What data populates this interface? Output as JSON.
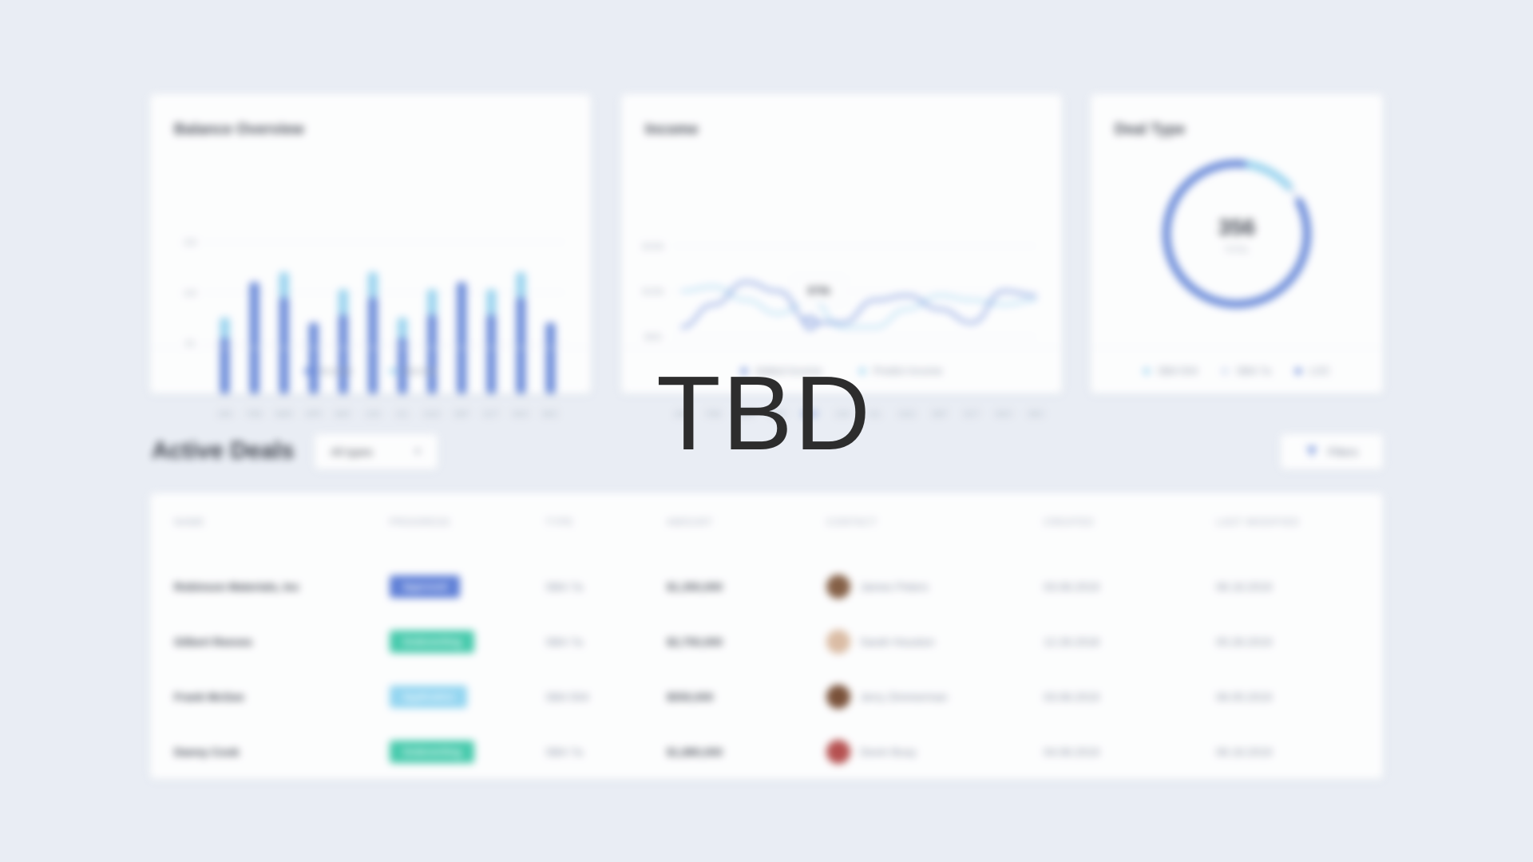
{
  "overlay_text": "TBD",
  "colors": {
    "primary": "#5b7fd6",
    "light": "#8fd0ee",
    "teal": "#34c6a4",
    "sky": "#8ad3f0",
    "background": "#e9edf4"
  },
  "balance": {
    "title": "Balance Overview",
    "legend": [
      "Income",
      "Borrow"
    ],
    "chart_data": {
      "type": "bar",
      "categories": [
        "JAN",
        "FEB",
        "MAR",
        "APR",
        "MAY",
        "JUN",
        "JUL",
        "AUG",
        "SEP",
        "OCT",
        "NOV",
        "DEC"
      ],
      "series": [
        {
          "name": "Income",
          "values": [
            55,
            110,
            95,
            70,
            78,
            95,
            55,
            78,
            110,
            78,
            95,
            70
          ]
        },
        {
          "name": "Borrow",
          "values": [
            20,
            0,
            25,
            0,
            25,
            25,
            20,
            25,
            0,
            25,
            25,
            0
          ]
        }
      ],
      "y_ticks": [
        "150",
        "100",
        "50"
      ],
      "ylim": [
        0,
        150
      ],
      "stacked": true
    }
  },
  "income": {
    "title": "Income",
    "legend": [
      "Added Income",
      "Predict Income"
    ],
    "tooltip": "$75k",
    "chart_data": {
      "type": "line",
      "categories": [
        "JAN",
        "FEB",
        "MAR",
        "APR",
        "MAY",
        "JUN",
        "JUL",
        "AUG",
        "SEP",
        "OCT",
        "NOV",
        "DEC"
      ],
      "highlight": "MAY",
      "series": [
        {
          "name": "Added Income",
          "values": [
            60,
            85,
            110,
            100,
            65,
            65,
            90,
            95,
            80,
            65,
            100,
            95
          ]
        },
        {
          "name": "Predict Income",
          "values": [
            100,
            105,
            90,
            75,
            90,
            60,
            60,
            80,
            95,
            90,
            85,
            90
          ]
        }
      ],
      "y_ticks": [
        "$150k",
        "$100k",
        "$50k"
      ],
      "ylim": [
        0,
        150
      ]
    }
  },
  "deal": {
    "title": "Deal Type",
    "total": "356",
    "total_label": "TOTAL",
    "legend": [
      "SBA 504",
      "SBA 7a",
      "LOC"
    ],
    "chart_data": {
      "type": "pie",
      "labels": [
        "SBA 504",
        "SBA 7a",
        "LOC"
      ],
      "values": [
        12,
        4,
        84
      ]
    }
  },
  "deals": {
    "title": "Active Deals",
    "filter_select": "All types",
    "filters_button": "Filters",
    "columns": [
      "NAME",
      "PROGRESS",
      "TYPE",
      "AMOUNT",
      "CONTACT",
      "CREATED",
      "LAST MODIFIED"
    ],
    "rows": [
      {
        "name": "Robinson Materials, Inc",
        "progress": "Approved",
        "badge": "primary",
        "type": "SBA 7a",
        "amount": "$1,350,000",
        "contact": "James Peters",
        "created": "03.06.2019",
        "modified": "06.16.2019",
        "avatar": "#7a5134"
      },
      {
        "name": "Gilbert Reeves",
        "progress": "Underwriting",
        "badge": "teal",
        "type": "SBA 7a",
        "amount": "$2,750,000",
        "contact": "Sarah Houston",
        "created": "12.26.2018",
        "modified": "05.26.2019",
        "avatar": "#d9b79c"
      },
      {
        "name": "Frank McGee",
        "progress": "Application",
        "badge": "sky",
        "type": "SBA 504",
        "amount": "$550,000",
        "contact": "Jerry Zimmerman",
        "created": "03.06.2019",
        "modified": "06.05.2019",
        "avatar": "#6e4126"
      },
      {
        "name": "Danny Cook",
        "progress": "Underwriting",
        "badge": "teal",
        "type": "SBA 7a",
        "amount": "$1,880,000",
        "contact": "Devin Busy",
        "created": "04.06.2019",
        "modified": "06.16.2019",
        "avatar": "#b0403f"
      }
    ]
  }
}
